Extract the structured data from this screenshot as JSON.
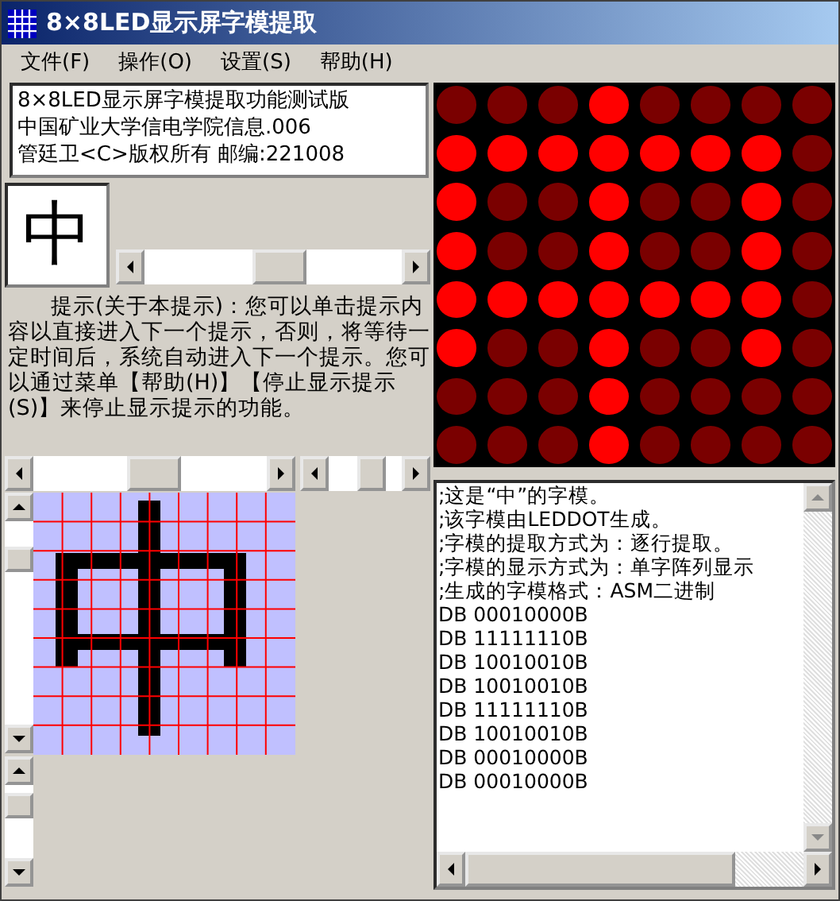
{
  "window": {
    "title": "8×8LED显示屏字模提取"
  },
  "menu": [
    {
      "label": "文件(F)"
    },
    {
      "label": "操作(O)"
    },
    {
      "label": "设置(S)"
    },
    {
      "label": "帮助(H)"
    }
  ],
  "info_box": {
    "lines": [
      "8×8LED显示屏字模提取功能测试版",
      "中国矿业大学信电学院信息.006",
      "管廷卫<C>版权所有 邮编:221008"
    ]
  },
  "preview_char": "中",
  "hint": "提示(关于本提示)：您可以单击提示内容以直接进入下一个提示，否则，将等待一定时间后，系统自动进入下一个提示。您可以通过菜单【帮助(H)】【停止显示提示(S)】来停止显示提示的功能。",
  "led_matrix": {
    "rows": [
      [
        {
          "on": false
        },
        {
          "on": false
        },
        {
          "on": false
        },
        {
          "on": true
        },
        {
          "on": false
        },
        {
          "on": false
        },
        {
          "on": false
        },
        {
          "on": false
        }
      ],
      [
        {
          "on": true
        },
        {
          "on": true
        },
        {
          "on": true
        },
        {
          "on": true
        },
        {
          "on": true
        },
        {
          "on": true
        },
        {
          "on": true
        },
        {
          "on": false
        }
      ],
      [
        {
          "on": true
        },
        {
          "on": false
        },
        {
          "on": false
        },
        {
          "on": true
        },
        {
          "on": false
        },
        {
          "on": false
        },
        {
          "on": true
        },
        {
          "on": false
        }
      ],
      [
        {
          "on": true
        },
        {
          "on": false
        },
        {
          "on": false
        },
        {
          "on": true
        },
        {
          "on": false
        },
        {
          "on": false
        },
        {
          "on": true
        },
        {
          "on": false
        }
      ],
      [
        {
          "on": true
        },
        {
          "on": true
        },
        {
          "on": true
        },
        {
          "on": true
        },
        {
          "on": true
        },
        {
          "on": true
        },
        {
          "on": true
        },
        {
          "on": false
        }
      ],
      [
        {
          "on": true
        },
        {
          "on": false
        },
        {
          "on": false
        },
        {
          "on": true
        },
        {
          "on": false
        },
        {
          "on": false
        },
        {
          "on": true
        },
        {
          "on": false
        }
      ],
      [
        {
          "on": false
        },
        {
          "on": false
        },
        {
          "on": false
        },
        {
          "on": true
        },
        {
          "on": false
        },
        {
          "on": false
        },
        {
          "on": false
        },
        {
          "on": false
        }
      ],
      [
        {
          "on": false
        },
        {
          "on": false
        },
        {
          "on": false
        },
        {
          "on": true
        },
        {
          "on": false
        },
        {
          "on": false
        },
        {
          "on": false
        },
        {
          "on": false
        }
      ]
    ]
  },
  "output": {
    "lines": [
      ";这是“中”的字模。",
      ";该字模由LEDDOT生成。",
      ";字模的提取方式为：逐行提取。",
      ";字模的显示方式为：单字阵列显示",
      ";生成的字模格式：ASM二进制",
      "DB 00010000B",
      "DB 11111110B",
      "DB 10010010B",
      "DB 10010010B",
      "DB 11111110B",
      "DB 10010010B",
      "DB 00010000B",
      "DB 00010000B"
    ]
  }
}
